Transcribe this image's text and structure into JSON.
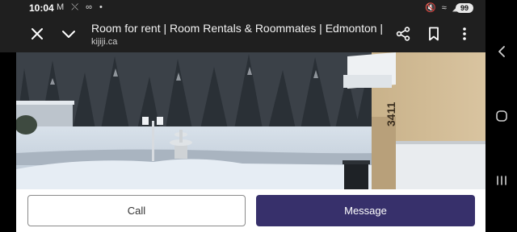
{
  "status_bar": {
    "time": "10:04",
    "left_icons": "M ⤬ ∞ •",
    "right_icons": "🔇 ≈ ◢",
    "battery": "99"
  },
  "toolbar": {
    "title": "Room for rent | Room Rentals & Roommates | Edmonton | ...",
    "url": "kijiji.ca",
    "icons": [
      "close-icon",
      "chevron-down-icon",
      "share-icon",
      "bookmark-icon",
      "more-vert-icon"
    ]
  },
  "photo": {
    "house_number": "3411"
  },
  "actions": {
    "call_label": "Call",
    "message_label": "Message",
    "message_color": "#37306b"
  },
  "navigation": {
    "icons": [
      "back-icon",
      "home-icon",
      "recents-icon"
    ]
  }
}
